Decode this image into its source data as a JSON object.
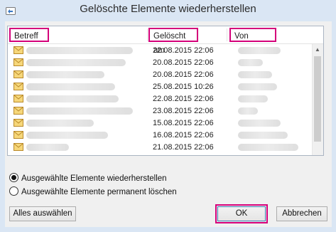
{
  "window": {
    "title": "Gelöschte Elemente wiederherstellen"
  },
  "columns": {
    "subject": "Betreff",
    "deleted": "Gelöscht am",
    "from": "Von"
  },
  "rows": [
    {
      "date": "22.08.2015 22:06"
    },
    {
      "date": "20.08.2015 22:06"
    },
    {
      "date": "20.08.2015 22:06"
    },
    {
      "date": "25.08.2015 10:26"
    },
    {
      "date": "22.08.2015 22:06"
    },
    {
      "date": "23.08.2015 22:06"
    },
    {
      "date": "15.08.2015 22:06"
    },
    {
      "date": "16.08.2015 22:06"
    },
    {
      "date": "21.08.2015 22:06"
    }
  ],
  "options": {
    "restore": "Ausgewählte Elemente wiederherstellen",
    "purge": "Ausgewählte Elemente permanent löschen",
    "selected": "restore"
  },
  "buttons": {
    "select_all": "Alles auswählen",
    "ok": "OK",
    "cancel": "Abbrechen"
  },
  "colors": {
    "highlight": "#d4007a",
    "frame": "#dae6f4"
  }
}
